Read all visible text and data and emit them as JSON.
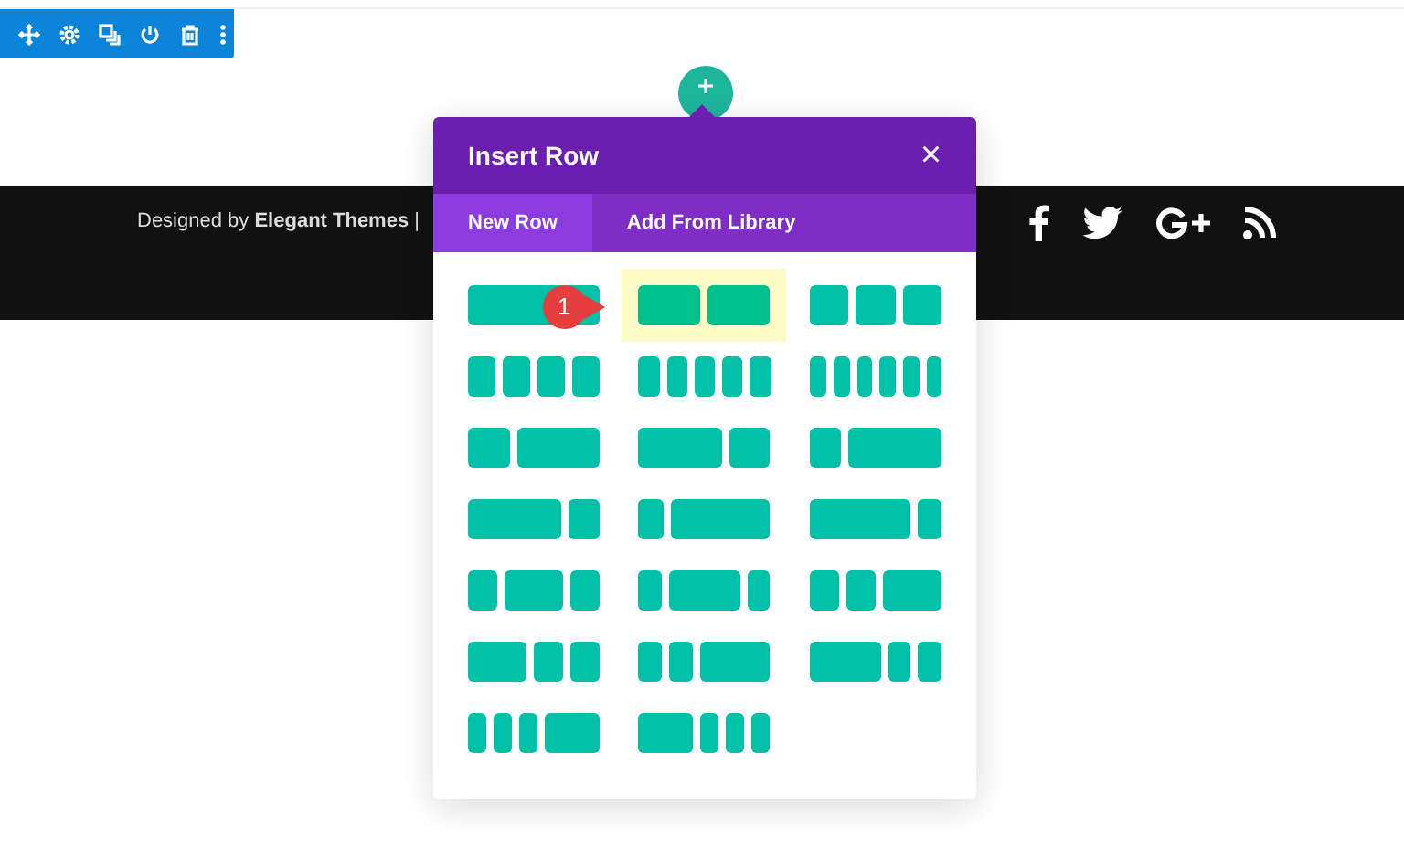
{
  "toolbar": {
    "buttons": [
      {
        "kind": "move"
      },
      {
        "kind": "settings"
      },
      {
        "kind": "duplicate"
      },
      {
        "kind": "power"
      },
      {
        "kind": "delete"
      },
      {
        "kind": "more"
      }
    ]
  },
  "footer": {
    "credit": "Designed by **Elegant Themes** |",
    "social": [
      {
        "kind": "facebook"
      },
      {
        "kind": "twitter"
      },
      {
        "kind": "googleplus"
      },
      {
        "kind": "rss"
      }
    ]
  },
  "dialog": {
    "title": "Insert Row",
    "close": "×",
    "tabs": [
      {
        "label": "New Row",
        "selected": true
      },
      {
        "label": "Add From Library",
        "selected": false
      }
    ],
    "callout": "1",
    "layouts": [
      {
        "selected": false
      },
      {
        "selected": true
      },
      {
        "selected": false
      },
      {
        "selected": false
      },
      {
        "selected": false
      },
      {
        "selected": false
      },
      {
        "selected": false
      },
      {
        "selected": false
      },
      {
        "selected": false
      },
      {
        "selected": false
      },
      {
        "selected": false
      },
      {
        "selected": false
      },
      {
        "selected": false
      },
      {
        "selected": false
      },
      {
        "selected": false
      },
      {
        "selected": false
      },
      {
        "selected": false
      },
      {
        "selected": false
      },
      {
        "selected": false
      },
      {
        "selected": false
      }
    ]
  }
}
